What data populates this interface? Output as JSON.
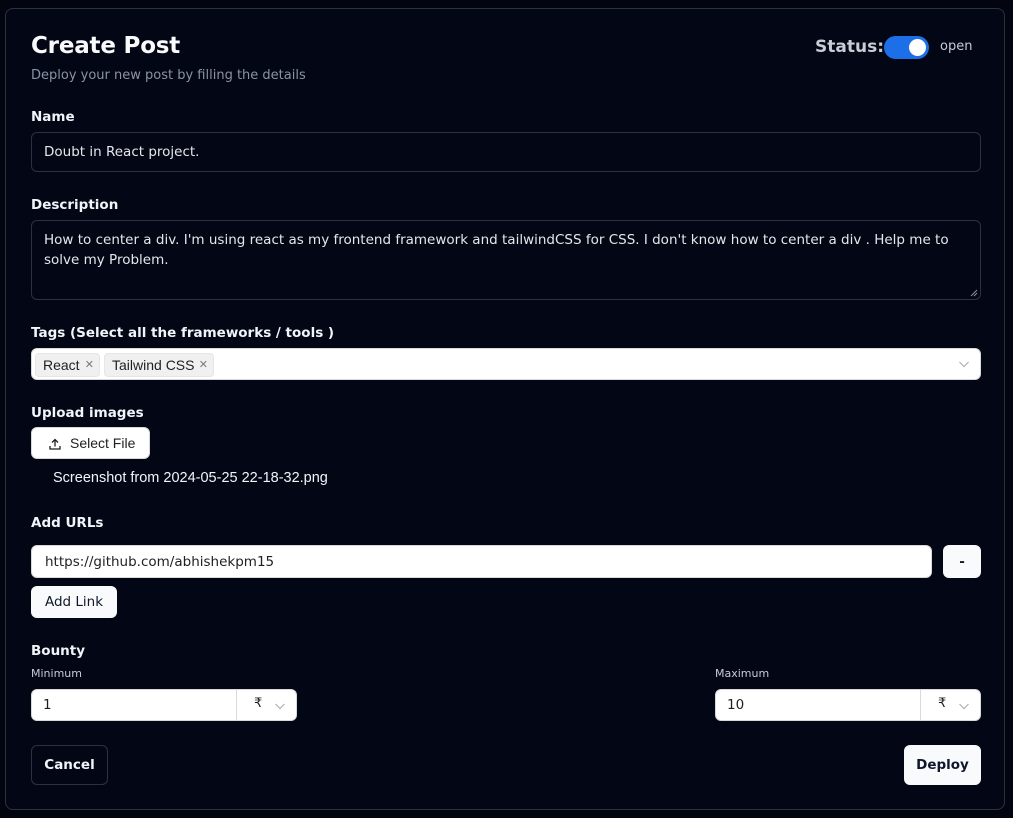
{
  "header": {
    "title": "Create Post",
    "subtitle": "Deploy your new post by filling the details",
    "status_label": "Status:",
    "status_value": "open",
    "status_on": true,
    "toggle_color": "#1d6fe8"
  },
  "name": {
    "label": "Name",
    "value": "Doubt in React project."
  },
  "description": {
    "label": "Description",
    "value": "How to center a div. I'm using react as my frontend framework and tailwindCSS for CSS. I don't know how to center a div . Help me to solve my Problem."
  },
  "tags": {
    "label": "Tags  (Select all the frameworks / tools )",
    "selected": [
      "React",
      "Tailwind CSS"
    ],
    "remove_icon": "close-icon",
    "dropdown_icon": "chevron-down-icon"
  },
  "upload": {
    "label": "Upload images",
    "button_label": "Select File",
    "button_icon": "upload-icon",
    "files": [
      "Screenshot from 2024-05-25 22-18-32.png"
    ]
  },
  "urls": {
    "label": "Add URLs",
    "items": [
      "https://github.com/abhishekpm15"
    ],
    "remove_label": "-",
    "add_label": "Add Link"
  },
  "bounty": {
    "label": "Bounty",
    "minimum_label": "Minimum",
    "minimum_value": "1",
    "maximum_label": "Maximum",
    "maximum_value": "10",
    "currency": "₹"
  },
  "footer": {
    "cancel_label": "Cancel",
    "deploy_label": "Deploy"
  }
}
